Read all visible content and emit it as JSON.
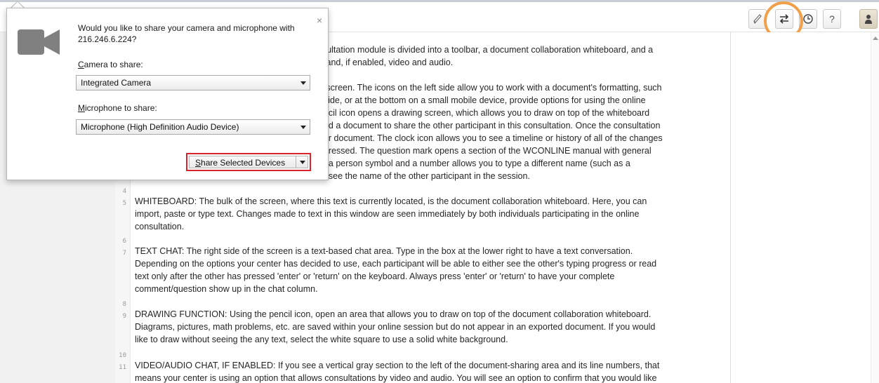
{
  "toolbar": {
    "buttons": [
      {
        "name": "pencil",
        "glyph": "✎"
      },
      {
        "name": "swap",
        "glyph": "⇄"
      },
      {
        "name": "clock",
        "glyph": "◷"
      },
      {
        "name": "help",
        "glyph": "?"
      },
      {
        "name": "person",
        "glyph": "▲"
      }
    ],
    "highlight_color": "#f0a04a"
  },
  "popup": {
    "message": "Would you like to share your camera and microphone with 216.246.6.224?",
    "close_glyph": "×",
    "camera_label_accel": "C",
    "camera_label_rest": "amera to share:",
    "camera_value": "Integrated Camera",
    "mic_label_accel": "M",
    "mic_label_rest": "icrophone to share:",
    "mic_value": "Microphone (High Definition Audio Device)",
    "share_accel": "S",
    "share_rest": "hare Selected Devices",
    "share_border_color": "#d9232d"
  },
  "document": {
    "paragraphs": [
      {
        "line": "",
        "lines": [
          "nsultation module is divided into a toolbar, a document collaboration whiteboard, and a",
          "w and, if enabled, video and audio."
        ]
      },
      {
        "line": "",
        "lines": [
          "e screen. The icons on the left side allow you to work with a document's formatting, such",
          "t side, or at the bottom on a small mobile device, provide options for using the online",
          "encil icon opens a drawing screen, which allows you to draw on top of the whiteboard",
          "oad a document to share the other participant in this consultation.  Once the consultation",
          "our document.  The clock icon allows you to see a timeline or history of all of the changes",
          "ogressed. The question mark opens a section of the WCONLINE manual with general",
          "th a person symbol and a number allows you to type a different name (such as a",
          "to see the name of the other participant in the session."
        ]
      },
      {
        "line": "5",
        "lines": [
          "WHITEBOARD: The bulk of the screen, where this text is currently located, is the document collaboration whiteboard.  Here, you can",
          "import, paste or type text. Changes made to text in this window are seen immediately by both individuals participating in the online",
          "consultation."
        ]
      },
      {
        "line": "7",
        "lines": [
          "TEXT CHAT: The right side of the screen is a text-based chat area. Type in the box at the lower right to have a text conversation.",
          "Depending on the options your center has decided to use, each participant will be able to either see the other's typing progress or read",
          "text only after the other has pressed 'enter' or 'return' on the keyboard. Always press 'enter' or 'return' to have your complete",
          "comment/question show up in the chat column."
        ]
      },
      {
        "line": "9",
        "lines": [
          "DRAWING FUNCTION: Using the pencil icon, open an area that allows you to draw on top of the document collaboration whiteboard.",
          "Diagrams, pictures, math problems, etc. are saved within your online session but do not appear in an exported document. If you would",
          "like to draw without seeing the any text, select the white square to use a solid white background."
        ]
      },
      {
        "line": "11",
        "lines": [
          "VIDEO/AUDIO CHAT, IF ENABLED: If you see a vertical gray section to the left of the document-sharing area and its line numbers, that",
          "means your center is using an option that allows consultations by video and audio. You will see an option to confirm that you would like"
        ]
      }
    ],
    "blank_line_numbers": [
      "4",
      "6",
      "8",
      "10"
    ]
  }
}
